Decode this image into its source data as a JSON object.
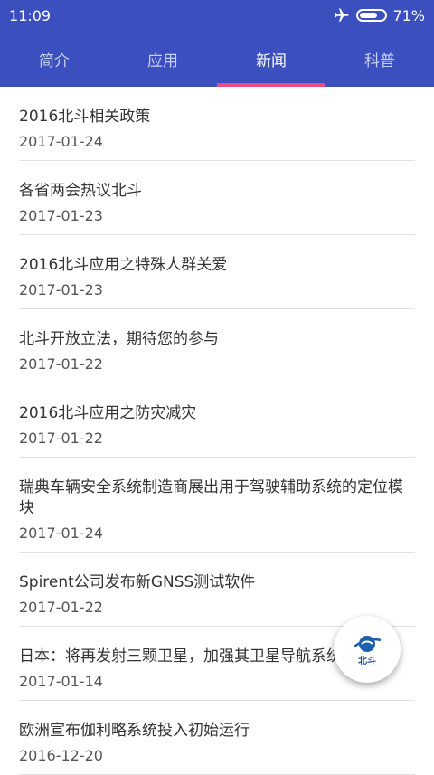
{
  "status": {
    "time": "11:09",
    "battery": "71%",
    "battery_level": 0.71
  },
  "tabs": [
    {
      "label": "简介"
    },
    {
      "label": "应用"
    },
    {
      "label": "新闻",
      "active": true
    },
    {
      "label": "科普"
    }
  ],
  "news": [
    {
      "title": "2016北斗相关政策",
      "date": "2017-01-24"
    },
    {
      "title": "各省两会热议北斗",
      "date": "2017-01-23"
    },
    {
      "title": "2016北斗应用之特殊人群关爱",
      "date": "2017-01-23"
    },
    {
      "title": "北斗开放立法，期待您的参与",
      "date": "2017-01-22"
    },
    {
      "title": "2016北斗应用之防灾减灾",
      "date": "2017-01-22"
    },
    {
      "title": "瑞典车辆安全系统制造商展出用于驾驶辅助系统的定位模块",
      "date": "2017-01-24"
    },
    {
      "title": "Spirent公司发布新GNSS测试软件",
      "date": "2017-01-22"
    },
    {
      "title": "日本：将再发射三颗卫星，加强其卫星导航系统",
      "date": "2017-01-14"
    },
    {
      "title": "欧洲宣布伽利略系统投入初始运行",
      "date": "2016-12-20"
    }
  ],
  "fab": {
    "label": "北斗",
    "icon": "beidou-logo-icon"
  }
}
